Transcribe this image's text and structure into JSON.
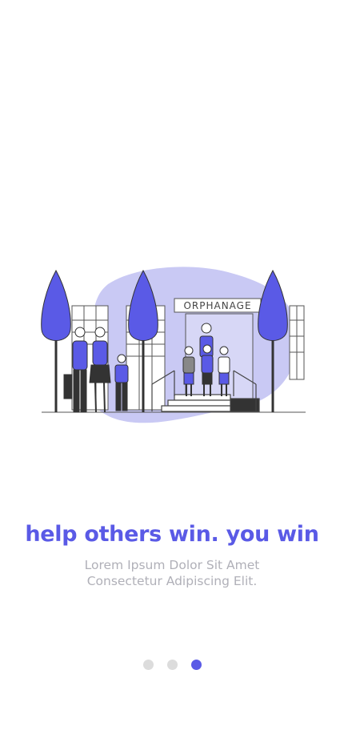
{
  "illustration": {
    "sign_text": "ORPHANAGE",
    "accent_color": "#5a5ae6",
    "blob_color": "#c9c9f4"
  },
  "onboarding": {
    "title": "help others win. you win",
    "subtitle_line1": "Lorem Ipsum Dolor Sit Amet",
    "subtitle_line2": "Consectetur Adipiscing Elit."
  },
  "pagination": {
    "total": 3,
    "active_index": 2
  }
}
